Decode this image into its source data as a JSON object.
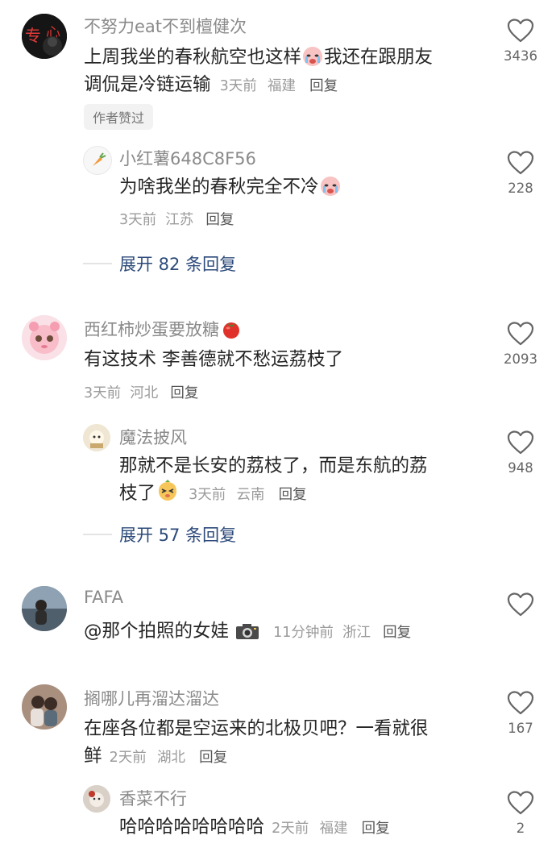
{
  "comments": [
    {
      "user": "不努力eat不到檀健次",
      "text_a": "上周我坐的春秋航空也这样",
      "text_b": "我还在跟朋友",
      "text_c": "调侃是冷链运输",
      "time": "3天前",
      "location": "福建",
      "reply": "回复",
      "badge": "作者赞过",
      "likes": "3436",
      "avatar_icon": "red-neon-avatar",
      "emoji_icon": "crying-face-icon",
      "sub": {
        "user": "小红薯648C8F56",
        "text": "为啥我坐的春秋完全不冷",
        "time": "3天前",
        "location": "江苏",
        "reply": "回复",
        "likes": "228",
        "avatar_icon": "carrot-avatar",
        "emoji_icon": "crying-face-icon"
      },
      "expand": "展开 82 条回复"
    },
    {
      "user": "西红柿炒蛋要放糖",
      "user_emoji": "tomato-icon",
      "text": "有这技术 李善德就不愁运荔枝了",
      "time": "3天前",
      "location": "河北",
      "reply": "回复",
      "likes": "2093",
      "avatar_icon": "pink-doll-avatar",
      "sub": {
        "user": "魔法披风",
        "text_a": "那就不是长安的荔枝了，而是东航的荔",
        "text_b": "枝了",
        "time": "3天前",
        "location": "云南",
        "reply": "回复",
        "likes": "948",
        "avatar_icon": "cartoon-avatar",
        "emoji_icon": "squinting-face-icon"
      },
      "expand": "展开 57 条回复"
    },
    {
      "user": "FAFA",
      "text": "@那个拍照的女娃",
      "emoji_icon": "camera-icon",
      "time": "11分钟前",
      "location": "浙江",
      "reply": "回复",
      "likes": "",
      "avatar_icon": "girl-sea-avatar"
    },
    {
      "user": "搁哪儿再溜达溜达",
      "text_a": "在座各位都是空运来的北极贝吧？一看就很",
      "text_b": "鲜",
      "time": "2天前",
      "location": "湖北",
      "reply": "回复",
      "likes": "167",
      "avatar_icon": "girls-avatar",
      "sub": {
        "user": "香菜不行",
        "text": "哈哈哈哈哈哈哈哈",
        "time": "2天前",
        "location": "福建",
        "reply": "回复",
        "likes": "2",
        "avatar_icon": "dog-avatar"
      }
    }
  ],
  "colors": {
    "link": "#2c4a7a",
    "meta": "#9b9b9b",
    "username": "#8a8a8a"
  }
}
